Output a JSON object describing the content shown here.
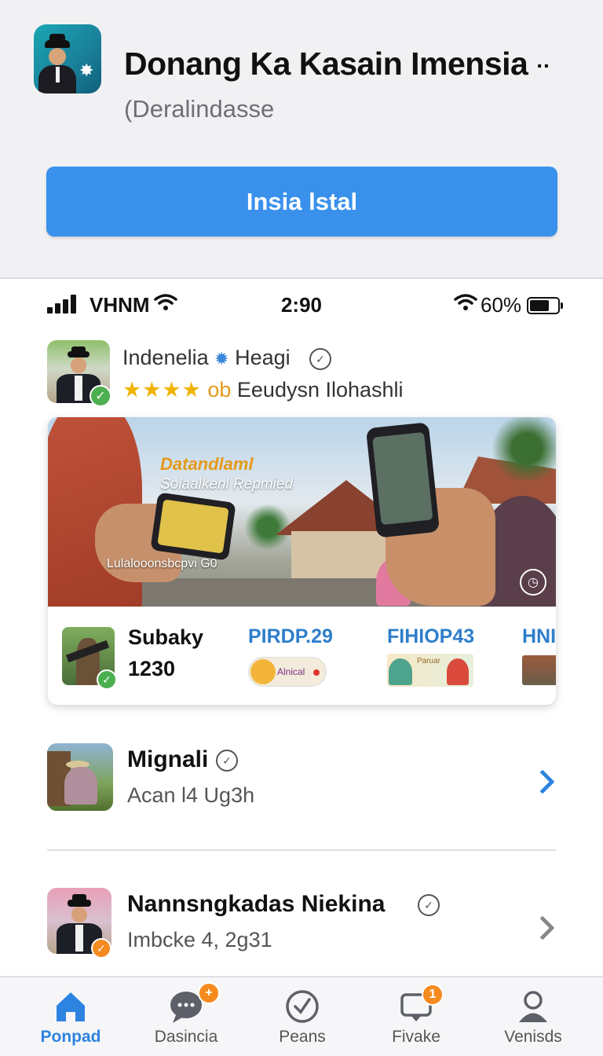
{
  "banner": {
    "app_title": "Donang Ka Kasain Imensia",
    "more_glyph": "··",
    "app_subtitle": "(Deralindasse",
    "install_label": "Insia lstal"
  },
  "status_bar": {
    "carrier": "VHNM",
    "time": "2:90",
    "battery_percent": "60%",
    "battery_level": 0.7
  },
  "profile": {
    "name": "Indenelia",
    "handle": "Heagi",
    "stars": "★★★★",
    "rating_suffix": "ob",
    "tagline": "Eeudysn Ilohashli"
  },
  "feature": {
    "scene_title": "Datandlaml",
    "scene_subtitle": "Solaalkenl Repmied",
    "scene_caption": "Lulalooonsbcpvi G0",
    "items": [
      {
        "title": "Subaky",
        "value": "1230"
      },
      {
        "title": "PIRDP.29",
        "pill_text": "Alnical"
      },
      {
        "title": "FIHIOP43",
        "image_text": "Paruar"
      },
      {
        "title": "HNI"
      }
    ]
  },
  "list": [
    {
      "title": "Mignali",
      "subtitle": "Acan l4  Ug3h"
    },
    {
      "title": "Nannsngkadas Niekina",
      "subtitle": "Imbcke 4, 2g31"
    }
  ],
  "tabs": [
    {
      "label": "Ponpad",
      "active": true
    },
    {
      "label": "Dasincia",
      "badge": "+"
    },
    {
      "label": "Peans"
    },
    {
      "label": "Fivake",
      "badge": "1"
    },
    {
      "label": "Venisds"
    }
  ],
  "colors": {
    "accent": "#3991ec",
    "active_tab": "#2d83e0",
    "badge": "#f58a1f",
    "verified": "#4caf50",
    "stars": "#f0b400"
  },
  "icons": {
    "home": "home-icon",
    "chat": "chat-bubble-icon",
    "circle_check": "circle-check-icon",
    "inbox": "inbox-icon",
    "profile": "person-icon"
  }
}
